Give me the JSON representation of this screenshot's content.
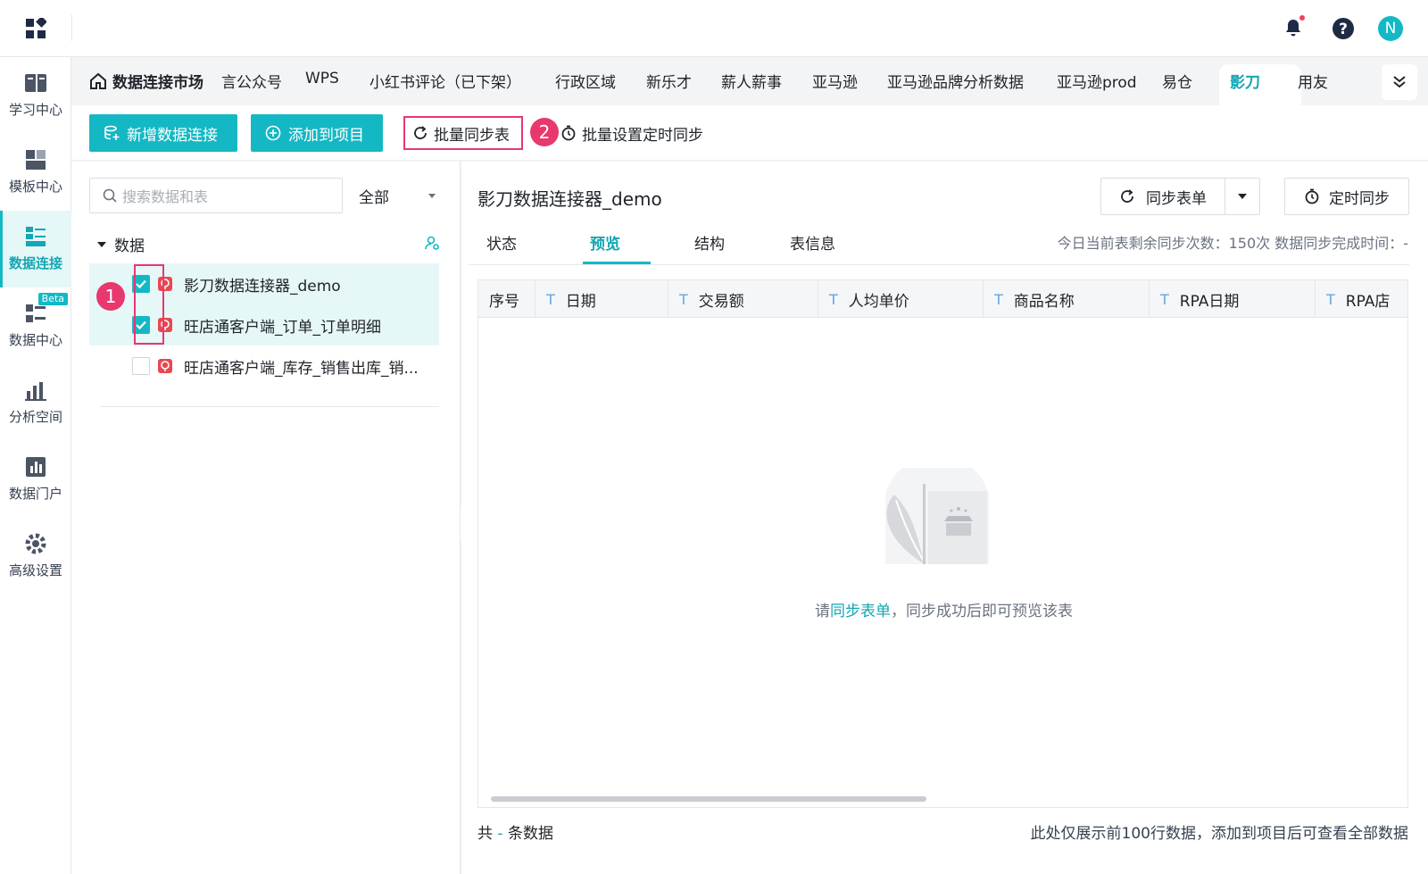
{
  "header": {
    "avatar_letter": "N"
  },
  "sidebar": {
    "items": [
      {
        "label": "学习中心",
        "icon": "book-icon"
      },
      {
        "label": "模板中心",
        "icon": "template-icon"
      },
      {
        "label": "数据连接",
        "icon": "data-connection-icon",
        "active": true
      },
      {
        "label": "数据中心",
        "icon": "data-center-icon",
        "badge": "Beta"
      },
      {
        "label": "分析空间",
        "icon": "analysis-icon"
      },
      {
        "label": "数据门户",
        "icon": "portal-icon"
      },
      {
        "label": "高级设置",
        "icon": "gear-icon"
      }
    ]
  },
  "tabs": {
    "home": "数据连接市场",
    "items": [
      "言公众号",
      "WPS",
      "小红书评论（已下架）",
      "行政区域",
      "新乐才",
      "薪人薪事",
      "亚马逊",
      "亚马逊品牌分析数据",
      "亚马逊prod",
      "易仓",
      "影刀",
      "用友"
    ],
    "active": "影刀"
  },
  "toolbar": {
    "new_connection": "新增数据连接",
    "add_to_project": "添加到项目",
    "batch_sync": "批量同步表",
    "batch_schedule": "批量设置定时同步",
    "step1": "1",
    "step2": "2"
  },
  "left_panel": {
    "search_placeholder": "搜索数据和表",
    "filter_value": "全部",
    "tree_root": "数据",
    "rows": [
      {
        "label": "影刀数据连接器_demo",
        "checked": true
      },
      {
        "label": "旺店通客户端_订单_订单明细",
        "checked": true
      },
      {
        "label": "旺店通客户端_库存_销售出库_销...",
        "checked": false
      }
    ]
  },
  "right_panel": {
    "title": "影刀数据连接器_demo",
    "sync_button": "同步表单",
    "schedule_button": "定时同步",
    "subtabs": [
      "状态",
      "预览",
      "结构",
      "表信息"
    ],
    "active_subtab": "预览",
    "sync_info": "今日当前表剩余同步次数：150次   数据同步完成时间：-",
    "columns": [
      "序号",
      "日期",
      "交易额",
      "人均单价",
      "商品名称",
      "RPA日期",
      "RPA店"
    ],
    "empty_prefix": "请",
    "empty_link": "同步表单",
    "empty_suffix": "，同步成功后即可预览该表",
    "footer_prefix": "共",
    "footer_count": "-",
    "footer_suffix": "条数据",
    "footer_note": "此处仅展示前100行数据，添加到项目后可查看全部数据"
  },
  "colors": {
    "accent": "#14b8c4",
    "highlight": "#e8386e"
  }
}
